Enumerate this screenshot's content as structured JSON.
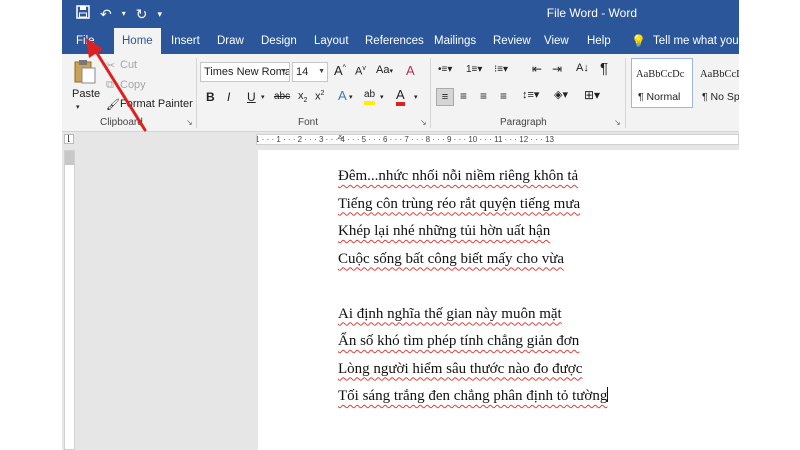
{
  "window": {
    "title": "File Word  -  Word"
  },
  "qat": {
    "save_icon": "save-icon",
    "undo_icon": "undo-icon",
    "redo_icon": "redo-icon",
    "customize_icon": "customize-icon"
  },
  "tabs": [
    "File",
    "Home",
    "Insert",
    "Draw",
    "Design",
    "Layout",
    "References",
    "Mailings",
    "Review",
    "View",
    "Help"
  ],
  "tell_me": "Tell me what you w",
  "clipboard": {
    "paste": "Paste",
    "cut": "Cut",
    "copy": "Copy",
    "format_painter": "Format Painter",
    "label": "Clipboard"
  },
  "font": {
    "name": "Times New Roma",
    "size": "14",
    "grow": "A",
    "shrink": "A",
    "case": "Aa",
    "clear": "A",
    "bold": "B",
    "italic": "I",
    "underline": "U",
    "strike": "abc",
    "sub": "x",
    "sup": "x",
    "effects": "A",
    "highlight": "ab",
    "color": "A",
    "label": "Font"
  },
  "paragraph": {
    "label": "Paragraph",
    "pilcrow": "¶"
  },
  "styles": {
    "preview1": "AaBbCcDc",
    "name1": "¶ Normal",
    "preview2": "AaBbCcD",
    "name2": "¶ No Spac"
  },
  "ruler": {
    "numbers": "1 · · · 1 · · · 2 · · · 3 · · · 4 · · · 5 · · · 6 · · · 7 · · · 8 · · · 9 · · · 10 · · · 11 · · · 12 · · · 13"
  },
  "document": {
    "lines": [
      "Đêm...nhức nhối nỗi niềm riêng khôn tả",
      "Tiếng côn trùng réo rắt quyện tiếng mưa",
      "Khép lại nhé những tủi hờn uất hận",
      "Cuộc sống bất công biết mấy cho vừa",
      "",
      "Ai định nghĩa thế gian này muôn mặt",
      "Ẩn số khó tìm phép tính chẳng giản đơn",
      "Lòng người hiểm sâu thước nào đo được",
      "Tối sáng trắng đen chẳng phân định tỏ tường"
    ]
  },
  "colors": {
    "accent": "#2b579a",
    "annotation_arrow": "#e02020",
    "spell_underline": "#e0403a"
  }
}
